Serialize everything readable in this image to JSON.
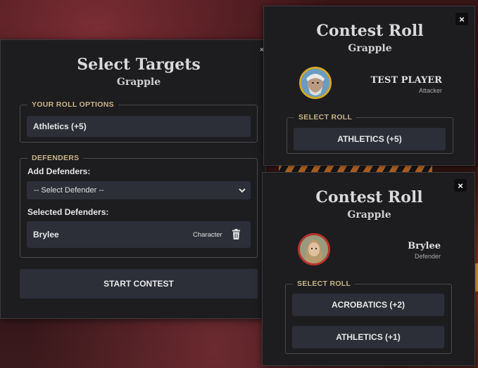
{
  "select_targets": {
    "title": "Select Targets",
    "subtitle": "Grapple",
    "roll_options_legend": "YOUR ROLL OPTIONS",
    "roll_option_value": "Athletics (+5)",
    "defenders_legend": "DEFENDERS",
    "add_defenders_label": "Add Defenders:",
    "select_placeholder": "-- Select Defender --",
    "selected_defenders_label": "Selected Defenders:",
    "selected": [
      {
        "name": "Brylee",
        "type": "Character"
      }
    ],
    "start_button": "START CONTEST"
  },
  "contest_attacker": {
    "title": "Contest Roll",
    "subtitle": "Grapple",
    "player_name": "TEST PLAYER",
    "role": "Attacker",
    "select_roll_legend": "SELECT ROLL",
    "rolls": [
      "ATHLETICS (+5)"
    ],
    "close": "×"
  },
  "contest_defender": {
    "title": "Contest Roll",
    "subtitle": "Grapple",
    "player_name": "Brylee",
    "role": "Defender",
    "select_roll_legend": "SELECT ROLL",
    "rolls": [
      "ACROBATICS (+2)",
      "ATHLETICS (+1)"
    ],
    "close": "×"
  },
  "colors": {
    "panel_bg": "#1d1d1f",
    "button_bg": "#2d2f38",
    "legend_gold": "#c8b487",
    "attacker_ring": "#d4a82a",
    "defender_ring": "#b8332b"
  }
}
